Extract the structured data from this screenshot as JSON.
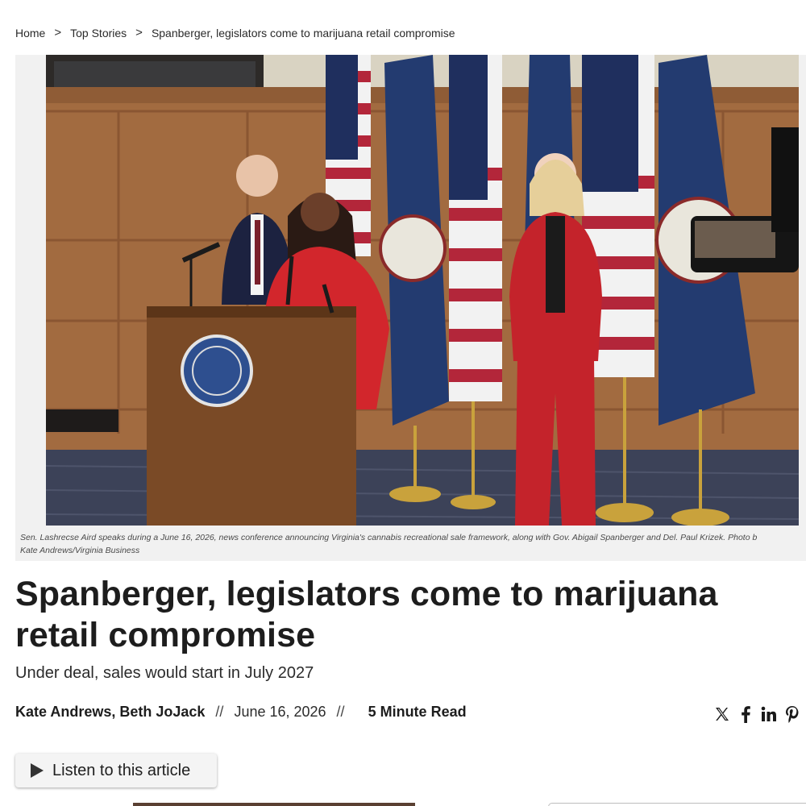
{
  "breadcrumb": {
    "items": [
      "Home",
      "Top Stories"
    ],
    "separator": ">",
    "current": "Spanberger, legislators come to marijuana retail compromise"
  },
  "figure": {
    "caption_line1": "Sen. Lashrecse Aird speaks during a June 16, 2026, news conference announcing Virginia's cannabis recreational sale framework, along with Gov. Abigail Spanberger and Del. Paul Krizek. Photo b",
    "caption_line2": "Kate Andrews/Virginia Business"
  },
  "article": {
    "headline": "Spanberger, legislators come to marijuana retail compromise",
    "subheadline": "Under deal, sales would start in July 2027",
    "authors": "Kate Andrews, Beth JoJack",
    "byline_separator": "//",
    "date": "June 16, 2026",
    "read_time": "5 Minute Read"
  },
  "share": {
    "icons": [
      "x-icon",
      "facebook-icon",
      "linkedin-icon",
      "pinterest-icon"
    ]
  },
  "listen": {
    "label": "Listen to this article",
    "icon": "play-icon"
  }
}
